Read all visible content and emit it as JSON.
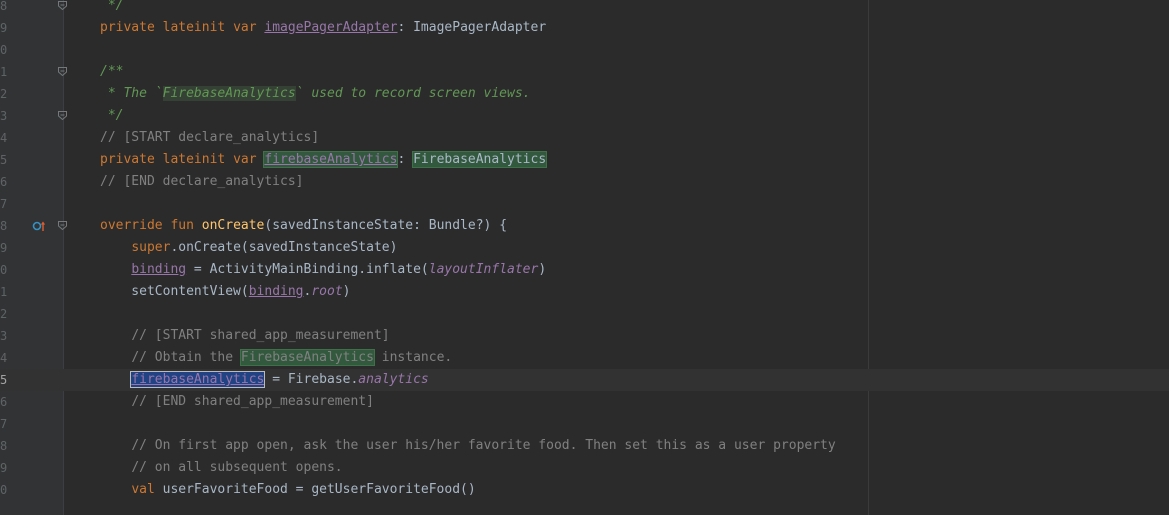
{
  "editor": {
    "lines": [
      {
        "num": "8",
        "segments": [
          {
            "t": " */",
            "c": "doc"
          }
        ]
      },
      {
        "num": "9",
        "segments": [
          {
            "t": "private ",
            "c": "kw"
          },
          {
            "t": "lateinit ",
            "c": "kw"
          },
          {
            "t": "var ",
            "c": "kw"
          },
          {
            "t": "imagePagerAdapter",
            "c": "prop"
          },
          {
            "t": ": ImagePagerAdapter",
            "c": ""
          }
        ]
      },
      {
        "num": "0",
        "segments": []
      },
      {
        "num": "1",
        "segments": [
          {
            "t": "/**",
            "c": "doc"
          }
        ]
      },
      {
        "num": "2",
        "segments": [
          {
            "t": " * The `",
            "c": "doc"
          },
          {
            "t": "FirebaseAnalytics",
            "c": "doc hlt"
          },
          {
            "t": "` used to record screen views.",
            "c": "doc"
          }
        ]
      },
      {
        "num": "3",
        "segments": [
          {
            "t": " */",
            "c": "doc"
          }
        ]
      },
      {
        "num": "4",
        "segments": [
          {
            "t": "// [START declare_analytics]",
            "c": "cm"
          }
        ]
      },
      {
        "num": "5",
        "segments": [
          {
            "t": "private ",
            "c": "kw"
          },
          {
            "t": "lateinit ",
            "c": "kw"
          },
          {
            "t": "var ",
            "c": "kw"
          },
          {
            "t": "firebaseAnalytics",
            "c": "prop hl"
          },
          {
            "t": ": ",
            "c": ""
          },
          {
            "t": "FirebaseAnalytics",
            "c": "hl"
          }
        ]
      },
      {
        "num": "6",
        "segments": [
          {
            "t": "// [END declare_analytics]",
            "c": "cm"
          }
        ]
      },
      {
        "num": "7",
        "segments": []
      },
      {
        "num": "8",
        "segments": [
          {
            "t": "override ",
            "c": "kw"
          },
          {
            "t": "fun ",
            "c": "kw"
          },
          {
            "t": "onCreate",
            "c": "fn"
          },
          {
            "t": "(savedInstanceState: Bundle?) {",
            "c": ""
          }
        ]
      },
      {
        "num": "9",
        "segments": [
          {
            "t": "    ",
            "c": ""
          },
          {
            "t": "super",
            "c": "kw"
          },
          {
            "t": ".onCreate(savedInstanceState)",
            "c": ""
          }
        ]
      },
      {
        "num": "0",
        "segments": [
          {
            "t": "    ",
            "c": ""
          },
          {
            "t": "binding",
            "c": "prop"
          },
          {
            "t": " = ActivityMainBinding.inflate(",
            "c": ""
          },
          {
            "t": "layoutInflater",
            "c": "propi"
          },
          {
            "t": ")",
            "c": ""
          }
        ]
      },
      {
        "num": "1",
        "segments": [
          {
            "t": "    setContentView(",
            "c": ""
          },
          {
            "t": "binding",
            "c": "prop"
          },
          {
            "t": ".",
            "c": ""
          },
          {
            "t": "root",
            "c": "propi"
          },
          {
            "t": ")",
            "c": ""
          }
        ]
      },
      {
        "num": "2",
        "segments": []
      },
      {
        "num": "3",
        "segments": [
          {
            "t": "    ",
            "c": ""
          },
          {
            "t": "// [START shared_app_measurement]",
            "c": "cm"
          }
        ]
      },
      {
        "num": "4",
        "segments": [
          {
            "t": "    ",
            "c": ""
          },
          {
            "t": "// Obtain the ",
            "c": "cm"
          },
          {
            "t": "FirebaseAnalytics",
            "c": "cm hl"
          },
          {
            "t": " instance.",
            "c": "cm"
          }
        ]
      },
      {
        "num": "5",
        "current": true,
        "segments": [
          {
            "t": "    ",
            "c": ""
          },
          {
            "t": "firebaseAnalytics",
            "c": "prop sel"
          },
          {
            "t": " = Firebase.",
            "c": ""
          },
          {
            "t": "analytics",
            "c": "propi"
          }
        ]
      },
      {
        "num": "6",
        "segments": [
          {
            "t": "    ",
            "c": ""
          },
          {
            "t": "// [END shared_app_measurement]",
            "c": "cm"
          }
        ]
      },
      {
        "num": "7",
        "segments": []
      },
      {
        "num": "8",
        "segments": [
          {
            "t": "    ",
            "c": ""
          },
          {
            "t": "// On first app open, ask the user his/her favorite food. Then set this as a user property",
            "c": "cm"
          }
        ]
      },
      {
        "num": "9",
        "segments": [
          {
            "t": "    ",
            "c": ""
          },
          {
            "t": "// on all subsequent opens.",
            "c": "cm"
          }
        ]
      },
      {
        "num": "0",
        "segments": [
          {
            "t": "    ",
            "c": ""
          },
          {
            "t": "val ",
            "c": "kw"
          },
          {
            "t": "userFavoriteFood = getUserFavoriteFood()",
            "c": ""
          }
        ]
      }
    ],
    "fold_markers": [
      0,
      3,
      5,
      10
    ],
    "override_marker_line": 10,
    "icons": {
      "fold": "fold-marker-icon",
      "override": "override-method-icon"
    }
  }
}
